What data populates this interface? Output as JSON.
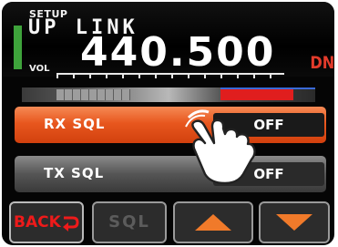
{
  "header": {
    "setup_label": "SETUP",
    "mode_label": "UP LINK",
    "volume_label": "VOL",
    "frequency": "440.500",
    "direction_label": "DN"
  },
  "menu": {
    "items": [
      {
        "label": "RX SQL",
        "value": "OFF",
        "selected": true
      },
      {
        "label": "TX SQL",
        "value": "OFF",
        "selected": false
      }
    ]
  },
  "softkeys": {
    "back_label": "BACK",
    "sql_label": "SQL",
    "up_icon": "triangle-up-icon",
    "down_icon": "triangle-down-icon"
  },
  "colors": {
    "selected_row": "#e8571e",
    "unselected_row": "#555555",
    "back_text": "#ee1a1a",
    "direction_text": "#e23b2b",
    "arrow_fill": "#f07a2a",
    "status_bar": "#3ea33b"
  }
}
